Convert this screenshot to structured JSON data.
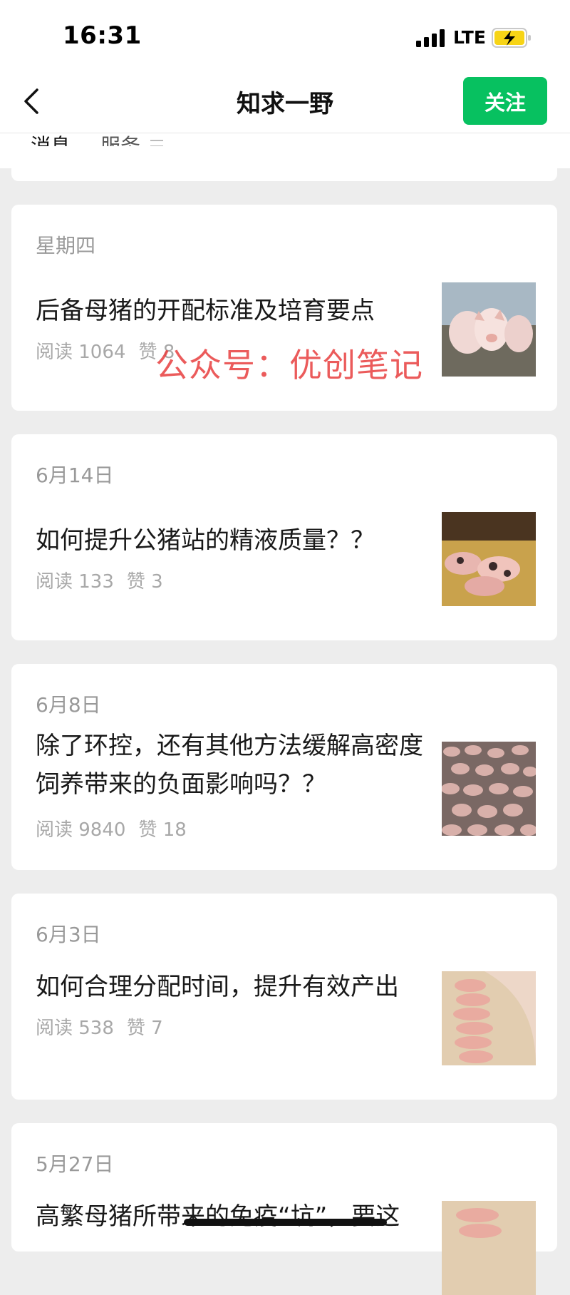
{
  "status_bar": {
    "time": "16:31",
    "network": "LTE"
  },
  "nav": {
    "title": "知求一野",
    "follow_label": "关注"
  },
  "tabs": [
    {
      "label": "消息"
    },
    {
      "label": "服务"
    }
  ],
  "articles": [
    {
      "date": "星期四",
      "title": "后备母猪的开配标准及培育要点",
      "reads": "阅读 1064",
      "likes": "赞 8"
    },
    {
      "date": "6月14日",
      "title": "如何提升公猪站的精液质量？？",
      "reads": "阅读 133",
      "likes": "赞 3"
    },
    {
      "date": "6月8日",
      "title": "除了环控，还有其他方法缓解高密度饲养带来的负面影响吗？？",
      "reads": "阅读 9840",
      "likes": "赞 18"
    },
    {
      "date": "6月3日",
      "title": "如何合理分配时间，提升有效产出",
      "reads": "阅读 538",
      "likes": "赞 7"
    },
    {
      "date": "5月27日",
      "title": "高繁母猪所带来的免疫“坑”，要这"
    }
  ],
  "watermark": "公众号：优创笔记",
  "colors": {
    "accent": "#07c160",
    "background": "#ededed",
    "watermark": "#e83e3e"
  },
  "icons": {
    "back": "chevron-left-icon",
    "battery": "battery-charging-icon",
    "signal": "signal-bars-icon",
    "menu": "menu-lines-icon"
  }
}
